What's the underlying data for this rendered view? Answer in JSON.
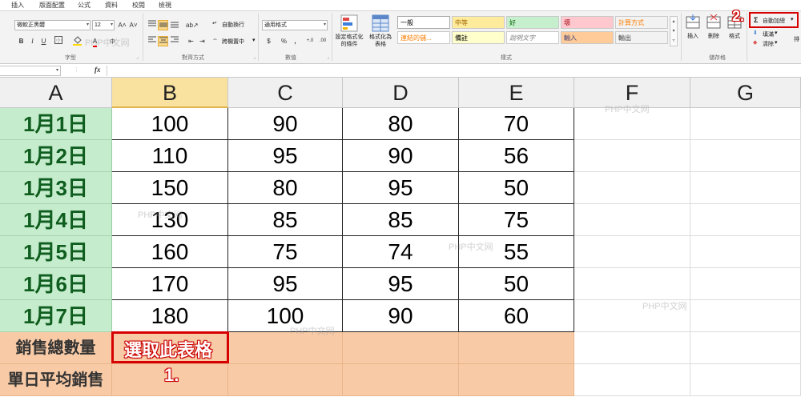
{
  "ribbon": {
    "tabs": [
      "插入",
      "版面配置",
      "公式",
      "資料",
      "校閱",
      "檢視"
    ],
    "font": {
      "font_name": "微軟正黑體",
      "font_size": "12",
      "grow_icon": "A˄",
      "shrink_icon": "A˅",
      "bold": "B",
      "italic": "I",
      "underline": "U",
      "font_color_glyph": "A",
      "group_label": "字型"
    },
    "alignment": {
      "wrap_text": "自動換行",
      "merge_center": "跨欄置中",
      "group_label": "對齊方式"
    },
    "number": {
      "format": "通用格式",
      "currency": "$",
      "percent": "%",
      "comma": ",",
      "inc_decimal": "+.0",
      "dec_decimal": ".00",
      "group_label": "數值"
    },
    "styles": {
      "conditional_formatting": [
        "設定格式化",
        "的條件"
      ],
      "format_as_table": [
        "格式化為",
        "表格"
      ],
      "cells": [
        {
          "label": "一般",
          "bg": "#ffffff",
          "color": "#000000"
        },
        {
          "label": "中等",
          "bg": "#ffeb9c",
          "color": "#9c6500"
        },
        {
          "label": "好",
          "bg": "#c6efce",
          "color": "#006100"
        },
        {
          "label": "壞",
          "bg": "#ffc7ce",
          "color": "#9c0006"
        },
        {
          "label": "計算方式",
          "bg": "#f2f2f2",
          "color": "#fa7d00"
        },
        {
          "label": "連結的儲...",
          "bg": "#ffffff",
          "color": "#fa7d00"
        },
        {
          "label": "備註",
          "bg": "#ffffcc",
          "color": "#000000"
        },
        {
          "label": "說明文字",
          "bg": "#ffffff",
          "color": "#7f7f7f"
        },
        {
          "label": "輸入",
          "bg": "#ffcc99",
          "color": "#3f3f76"
        },
        {
          "label": "輸出",
          "bg": "#f2f2f2",
          "color": "#3f3f3f"
        }
      ],
      "group_label": "樣式"
    },
    "cells_group": {
      "insert": "插入",
      "delete": "刪除",
      "format": "格式",
      "group_label": "儲存格"
    },
    "editing": {
      "autosum": "自動加總",
      "fill": "填滿",
      "clear": "清除",
      "sort_hint": "排"
    }
  },
  "formula_bar": {
    "name_box": "",
    "fx": "fx",
    "content": ""
  },
  "sheet": {
    "columns": [
      "A",
      "B",
      "C",
      "D",
      "E",
      "F",
      "G"
    ],
    "selected_column": "B",
    "rows": [
      {
        "date": "1月1日",
        "values": [
          "100",
          "90",
          "80",
          "70"
        ]
      },
      {
        "date": "1月2日",
        "values": [
          "110",
          "95",
          "90",
          "56"
        ]
      },
      {
        "date": "1月3日",
        "values": [
          "150",
          "80",
          "95",
          "50"
        ]
      },
      {
        "date": "1月4日",
        "values": [
          "130",
          "85",
          "85",
          "75"
        ]
      },
      {
        "date": "1月5日",
        "values": [
          "160",
          "75",
          "74",
          "55"
        ]
      },
      {
        "date": "1月6日",
        "values": [
          "170",
          "95",
          "95",
          "50"
        ]
      },
      {
        "date": "1月7日",
        "values": [
          "180",
          "100",
          "90",
          "60"
        ]
      }
    ],
    "summary_rows": [
      {
        "label": "銷售總數量"
      },
      {
        "label": "單日平均銷售"
      }
    ]
  },
  "annotations": {
    "select_cell": "選取此表格",
    "step1": "1.",
    "step2": "2."
  },
  "watermark": "PHP中文网",
  "colors": {
    "date_fill": "#c5eccc",
    "date_text": "#0f5d1f",
    "summary_fill": "#f8cba6",
    "annotation_red": "#d60000",
    "selected_header": "#f9e2a0"
  }
}
